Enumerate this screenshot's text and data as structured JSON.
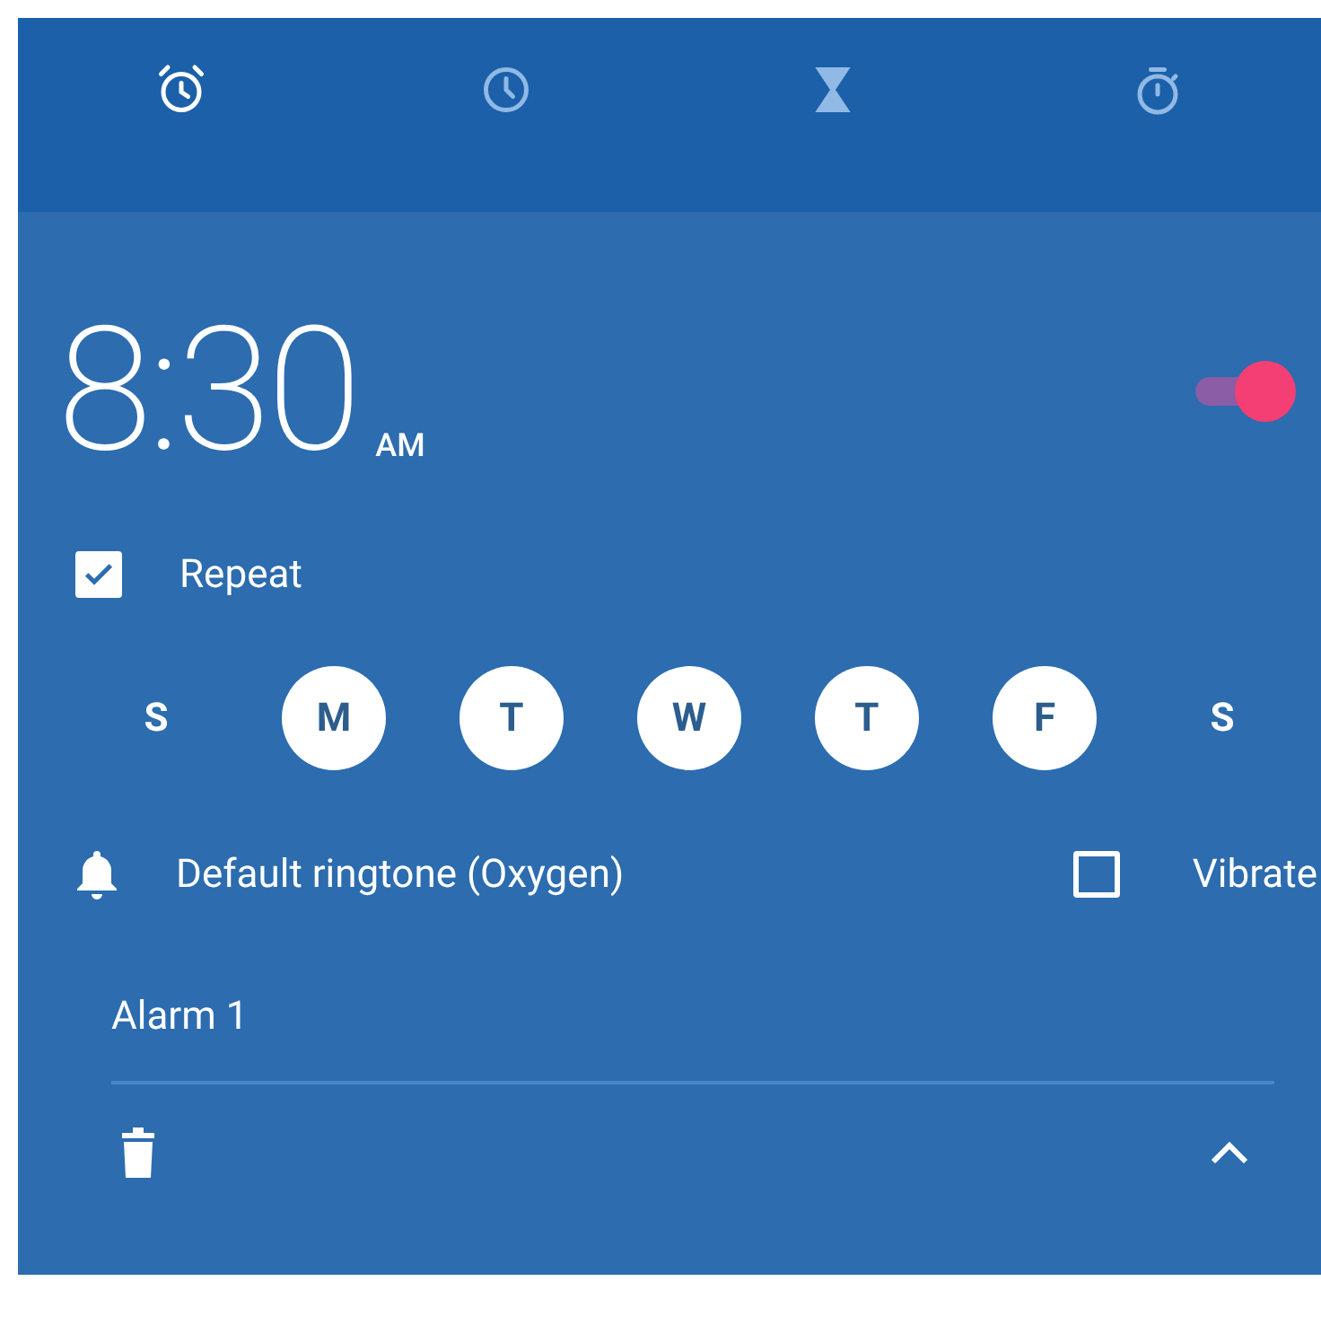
{
  "tabs": [
    {
      "kind": "alarm",
      "selected": true
    },
    {
      "kind": "clock",
      "selected": false
    },
    {
      "kind": "timer",
      "selected": false
    },
    {
      "kind": "stopwatch",
      "selected": false
    }
  ],
  "alarm": {
    "time": "8:30",
    "period": "AM",
    "on": true,
    "repeat": {
      "label": "Repeat",
      "checked": true
    },
    "days": [
      {
        "label": "S",
        "selected": false
      },
      {
        "label": "M",
        "selected": true
      },
      {
        "label": "T",
        "selected": true
      },
      {
        "label": "W",
        "selected": true
      },
      {
        "label": "T",
        "selected": true
      },
      {
        "label": "F",
        "selected": true
      },
      {
        "label": "S",
        "selected": false
      }
    ],
    "ringtone": "Default ringtone (Oxygen)",
    "vibrate": {
      "label": "Vibrate",
      "checked": false
    },
    "label": "Alarm 1"
  }
}
